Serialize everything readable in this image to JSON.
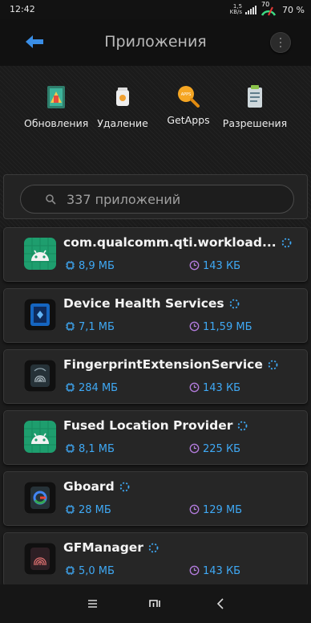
{
  "status": {
    "time": "12:42",
    "net_speed": "1,5\nKB/s",
    "gauge_value": "70",
    "battery": "70 %"
  },
  "appbar": {
    "title": "Приложения",
    "back_icon": "back-arrow-icon",
    "menu_icon": "more-vertical-icon"
  },
  "actions": [
    {
      "label": "Обновления",
      "icon": "updates-icon"
    },
    {
      "label": "Удаление",
      "icon": "uninstall-trash-icon"
    },
    {
      "label": "GetApps",
      "icon": "getapps-search-icon"
    },
    {
      "label": "Разрешения",
      "icon": "permissions-clipboard-icon"
    }
  ],
  "search": {
    "placeholder": "337 приложений",
    "icon": "search-icon"
  },
  "apps": [
    {
      "name": "com.qualcomm.qti.workload...",
      "size": "8,9 МБ",
      "cache": "143 КБ",
      "icon": "android-icon"
    },
    {
      "name": "Device Health Services",
      "size": "7,1 МБ",
      "cache": "11,59 МБ",
      "icon": "device-health-icon"
    },
    {
      "name": "FingerprintExtensionService",
      "size": "284 МБ",
      "cache": "143 КБ",
      "icon": "fingerprint-icon"
    },
    {
      "name": "Fused Location Provider",
      "size": "8,1 МБ",
      "cache": "225 КБ",
      "icon": "android-icon"
    },
    {
      "name": "Gboard",
      "size": "28 МБ",
      "cache": "129 МБ",
      "icon": "gboard-icon"
    },
    {
      "name": "GFManager",
      "size": "5,0 МБ",
      "cache": "143 КБ",
      "icon": "gf-fingerprint-icon"
    }
  ],
  "colors": {
    "accent_blue": "#3fa9f5",
    "clock_purple": "#b07ad9",
    "android_green": "#3ddc84",
    "back_arrow": "#3a8ee6"
  },
  "navbar": {
    "menu_icon": "recents-icon",
    "home_icon": "mi-home-icon",
    "back_icon": "nav-back-icon"
  }
}
